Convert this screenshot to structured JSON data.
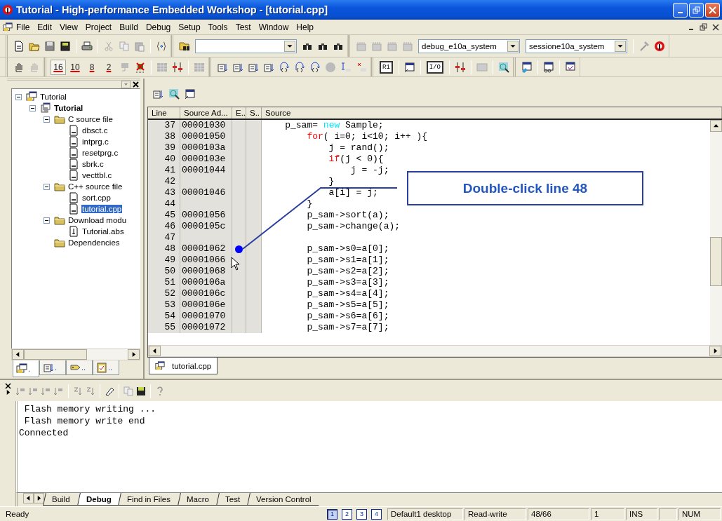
{
  "window": {
    "title": "Tutorial - High-performance Embedded Workshop - [tutorial.cpp]"
  },
  "menu": [
    "File",
    "Edit",
    "View",
    "Project",
    "Build",
    "Debug",
    "Setup",
    "Tools",
    "Test",
    "Window",
    "Help"
  ],
  "toolbar": {
    "build_configuration": "debug_e10a_system",
    "session": "sessione10a_system",
    "radix_buttons": [
      {
        "label": "16",
        "selected": true
      },
      {
        "label": "10",
        "selected": false
      },
      {
        "label": "8",
        "selected": false
      },
      {
        "label": "2",
        "selected": false
      }
    ],
    "register_button": "R1",
    "io_button": "I/O"
  },
  "workspace": {
    "tree": [
      {
        "label": "Tutorial",
        "kind": "workspace",
        "expanded": true,
        "selected": false,
        "children": [
          {
            "label": "Tutorial",
            "kind": "project",
            "expanded": true,
            "selected": false,
            "children": [
              {
                "label": "C source file",
                "kind": "folder",
                "expanded": true,
                "selected": false,
                "children": [
                  {
                    "label": "dbsct.c",
                    "kind": "file",
                    "selected": false
                  },
                  {
                    "label": "intprg.c",
                    "kind": "file",
                    "selected": false
                  },
                  {
                    "label": "resetprg.c",
                    "kind": "file",
                    "selected": false
                  },
                  {
                    "label": "sbrk.c",
                    "kind": "file",
                    "selected": false
                  },
                  {
                    "label": "vecttbl.c",
                    "kind": "file",
                    "selected": false
                  }
                ]
              },
              {
                "label": "C++ source file",
                "kind": "folder",
                "expanded": true,
                "selected": false,
                "children": [
                  {
                    "label": "sort.cpp",
                    "kind": "file",
                    "selected": false
                  },
                  {
                    "label": "tutorial.cpp",
                    "kind": "file",
                    "selected": true
                  }
                ]
              },
              {
                "label": "Download modu",
                "kind": "folder",
                "expanded": true,
                "selected": false,
                "children": [
                  {
                    "label": "Tutorial.abs",
                    "kind": "download",
                    "selected": false
                  }
                ]
              },
              {
                "label": "Dependencies",
                "kind": "folder",
                "selected": false
              }
            ]
          }
        ]
      }
    ],
    "tabs": [
      {
        "label": ".",
        "selected": true
      },
      {
        "label": ".",
        "selected": false
      },
      {
        "label": "..",
        "selected": false
      },
      {
        "label": "..",
        "selected": false
      }
    ]
  },
  "editor": {
    "columns": [
      "Line",
      "Source Ad...",
      "E..",
      "S..",
      "Source"
    ],
    "rows": [
      {
        "line": "37",
        "address": "00001030",
        "breakpoint": false,
        "source": [
          {
            "text": "    p_sam= ",
            "kind": "plain"
          },
          {
            "text": "new",
            "kind": "operator"
          },
          {
            "text": " Sample;",
            "kind": "plain"
          }
        ]
      },
      {
        "line": "38",
        "address": "00001050",
        "breakpoint": false,
        "source": [
          {
            "text": "        for",
            "kind": "keyword"
          },
          {
            "text": "( i=0; i<10; i++ ){",
            "kind": "plain"
          }
        ]
      },
      {
        "line": "39",
        "address": "0000103a",
        "breakpoint": false,
        "source": [
          {
            "text": "            j = rand();",
            "kind": "plain"
          }
        ]
      },
      {
        "line": "40",
        "address": "0000103e",
        "breakpoint": false,
        "source": [
          {
            "text": "            if",
            "kind": "keyword"
          },
          {
            "text": "(j < 0){",
            "kind": "plain"
          }
        ]
      },
      {
        "line": "41",
        "address": "00001044",
        "breakpoint": false,
        "source": [
          {
            "text": "                j = -j;",
            "kind": "plain"
          }
        ]
      },
      {
        "line": "42",
        "breakpoint": false,
        "source": [
          {
            "text": "            }",
            "kind": "plain"
          }
        ]
      },
      {
        "line": "43",
        "address": "00001046",
        "breakpoint": false,
        "source": [
          {
            "text": "            a[i] = j;",
            "kind": "plain"
          }
        ]
      },
      {
        "line": "44",
        "breakpoint": false,
        "source": [
          {
            "text": "        }",
            "kind": "plain"
          }
        ]
      },
      {
        "line": "45",
        "address": "00001056",
        "breakpoint": false,
        "source": [
          {
            "text": "        p_sam->sort(a);",
            "kind": "plain"
          }
        ]
      },
      {
        "line": "46",
        "address": "0000105c",
        "breakpoint": false,
        "source": [
          {
            "text": "        p_sam->change(a);",
            "kind": "plain"
          }
        ]
      },
      {
        "line": "47",
        "breakpoint": false
      },
      {
        "line": "48",
        "address": "00001062",
        "breakpoint": true,
        "source": [
          {
            "text": "        p_sam->s0=a[0];",
            "kind": "plain"
          }
        ]
      },
      {
        "line": "49",
        "address": "00001066",
        "breakpoint": false,
        "source": [
          {
            "text": "        p_sam->s1=a[1];",
            "kind": "plain"
          }
        ]
      },
      {
        "line": "50",
        "address": "00001068",
        "breakpoint": false,
        "source": [
          {
            "text": "        p_sam->s2=a[2];",
            "kind": "plain"
          }
        ]
      },
      {
        "line": "51",
        "address": "0000106a",
        "breakpoint": false,
        "source": [
          {
            "text": "        p_sam->s3=a[3];",
            "kind": "plain"
          }
        ]
      },
      {
        "line": "52",
        "address": "0000106c",
        "breakpoint": false,
        "source": [
          {
            "text": "        p_sam->s4=a[4];",
            "kind": "plain"
          }
        ]
      },
      {
        "line": "53",
        "address": "0000106e",
        "breakpoint": false,
        "source": [
          {
            "text": "        p_sam->s5=a[5];",
            "kind": "plain"
          }
        ]
      },
      {
        "line": "54",
        "address": "00001070",
        "breakpoint": false,
        "source": [
          {
            "text": "        p_sam->s6=a[6];",
            "kind": "plain"
          }
        ]
      },
      {
        "line": "55",
        "address": "00001072",
        "breakpoint": false,
        "source": [
          {
            "text": "        p_sam->s7=a[7];",
            "kind": "plain"
          }
        ]
      }
    ],
    "file_tab": "tutorial.cpp"
  },
  "callout": {
    "text": "Double-click line 48"
  },
  "output": {
    "lines": [
      " Flash memory writing ...",
      " Flash memory write end",
      "Connected"
    ],
    "tabs": [
      {
        "label": "Build",
        "selected": false
      },
      {
        "label": "Debug",
        "selected": true
      },
      {
        "label": "Find in Files",
        "selected": false
      },
      {
        "label": "Macro",
        "selected": false
      },
      {
        "label": "Test",
        "selected": false
      },
      {
        "label": "Version Control",
        "selected": false
      }
    ]
  },
  "status_bar": {
    "message": "Ready",
    "desktops": [
      {
        "label": "1",
        "selected": true
      },
      {
        "label": "2",
        "selected": false
      },
      {
        "label": "3",
        "selected": false
      },
      {
        "label": "4",
        "selected": false
      }
    ],
    "panes": [
      "Default1 desktop",
      "Read-write",
      "48/66",
      "1",
      "INS",
      "NUM"
    ]
  }
}
